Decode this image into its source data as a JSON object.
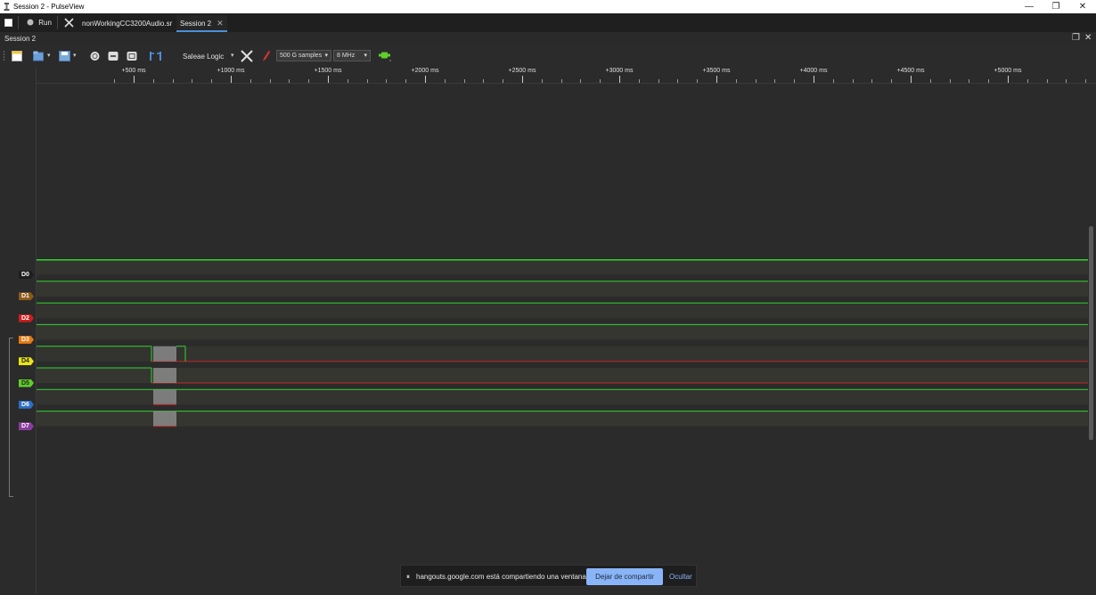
{
  "window": {
    "title": "Session 2 - PulseView",
    "controls": [
      "—",
      "❐",
      "✕"
    ]
  },
  "tabbar": {
    "run_label": "Run",
    "tabs": [
      {
        "label": "nonWorkingCC3200Audio.sr"
      },
      {
        "label": "Session 2"
      }
    ]
  },
  "session": {
    "label": "Session 2",
    "restore_icon": "❐",
    "close_icon": "✕"
  },
  "toolbar": {
    "device": "Saleae Logic",
    "samples": "500 G samples",
    "samplerate": "8 MHz"
  },
  "ruler": {
    "labels": [
      "+500 ms",
      "+1000 ms",
      "+1500 ms",
      "+2000 ms",
      "+2500 ms",
      "+3000 ms",
      "+3500 ms",
      "+4000 ms",
      "+4500 ms",
      "+5000 ms"
    ]
  },
  "channels": [
    {
      "name": "D0",
      "color": "#1e1e1e",
      "text": "#ffffff"
    },
    {
      "name": "D1",
      "color": "#8b5a1a",
      "text": "#ffffff"
    },
    {
      "name": "D2",
      "color": "#cc1f1f",
      "text": "#ffffff"
    },
    {
      "name": "D3",
      "color": "#e57b12",
      "text": "#ffffff"
    },
    {
      "name": "D4",
      "color": "#e8e21a",
      "text": "#222222"
    },
    {
      "name": "D5",
      "color": "#5ecf2a",
      "text": "#222222"
    },
    {
      "name": "D6",
      "color": "#2d6fc4",
      "text": "#ffffff"
    },
    {
      "name": "D7",
      "color": "#8a3d9e",
      "text": "#ffffff"
    }
  ],
  "notification": {
    "pause_icon": "⏸",
    "message": "hangouts.google.com está compartiendo una ventana.",
    "stop_label": "Dejar de compartir",
    "hide_label": "Ocultar"
  },
  "colors": {
    "signal_high": "#2fd52f",
    "signal_low": "#c42525",
    "accent": "#4a90d9"
  }
}
